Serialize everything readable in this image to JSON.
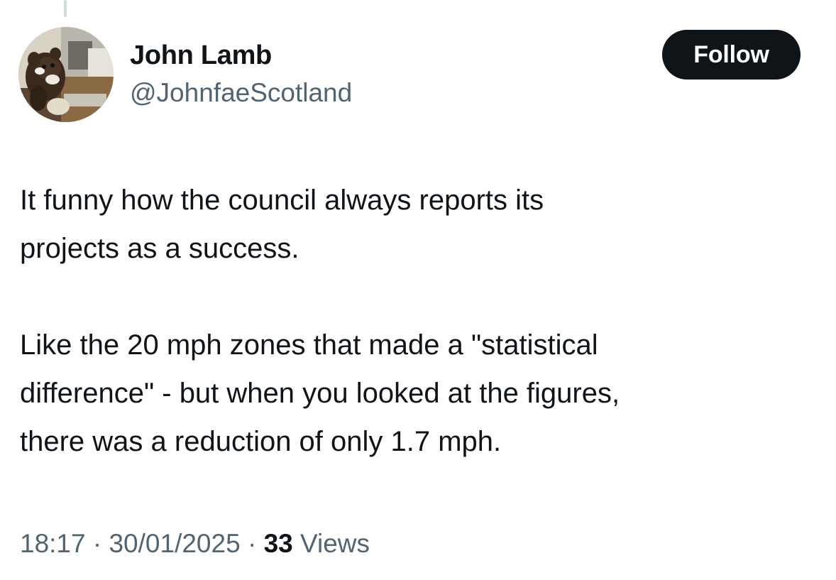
{
  "author": {
    "display_name": "John Lamb",
    "handle": "@JohnfaeScotland",
    "avatar_icon": "profile-photo"
  },
  "follow_button": {
    "label": "Follow"
  },
  "tweet": {
    "lines": [
      [
        "It funny how the council always reports its",
        "projects as a success."
      ],
      [
        "Like the 20 mph zones that made a \"statistical",
        "difference\" - but when you looked at the figures,",
        "there was a reduction of only 1.7 mph."
      ]
    ]
  },
  "meta": {
    "time": "18:17",
    "separator": " · ",
    "date": "30/01/2025",
    "views_count": "33",
    "views_label": " Views"
  },
  "colors": {
    "text_primary": "#0f1419",
    "text_secondary": "#536471",
    "button_bg": "#0f1419",
    "thread_line": "#cfd9de"
  }
}
